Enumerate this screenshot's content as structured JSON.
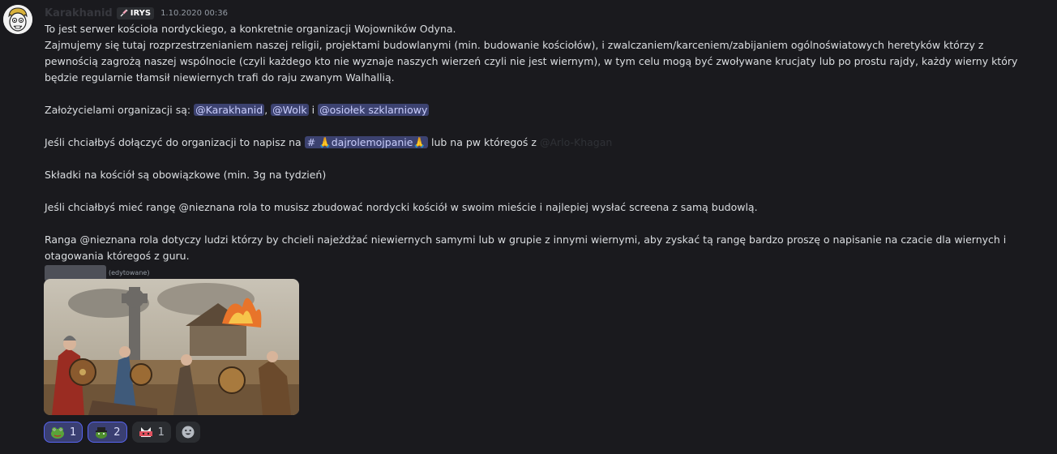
{
  "message": {
    "author": "Karakhanid",
    "role_badge": "IRYS",
    "timestamp": "1.10.2020 00:36",
    "line1": "To jest serwer kościoła nordyckiego, a konkretnie organizacji Wojowników Odyna.",
    "line2": "Zajmujemy się tutaj rozprzestrzenianiem naszej religii, projektami budowlanymi (min. budowanie kościołów), i zwalczaniem/karceniem/zabijaniem ogólnoświatowych heretyków którzy z pewnością zagrożą naszej wspólnocie (czyli każdego kto nie wyznaje naszych wierzeń czyli nie jest wiernym), w tym celu mogą być zwoływane krucjaty lub po prostu rajdy, każdy wierny który będzie regularnie tłamsił niewiernych trafi do raju zwanym Walhallią.",
    "founders_prefix": "Założycielami organizacji są: ",
    "founder1": "@Karakhanid",
    "sep1": ", ",
    "founder2": "@Wolk",
    "sep2": " i ",
    "founder3": "@osiołek szklarniowy",
    "join_prefix": "Jeśli chciałbyś dołączyć do organizacji to napisz na ",
    "channel_hash": "#",
    "channel_name": "🙏dajrolemojpanie🙏",
    "join_mid": " lub na pw któregoś z ",
    "join_user": "@Arlo-Khagan",
    "dues": "Składki na kościół są obowiązkowe (min. 3g na tydzień)",
    "rank_line": "Jeśli chciałbyś mieć rangę @nieznana rola  to musisz zbudować nordycki kościół w swoim mieście i najlepiej wysłać screena z samą budowlą.",
    "rank2_line": "Ranga @nieznana rola  dotyczy ludzi którzy by chcieli najeżdżać niewiernych samymi lub w grupie z innymi wiernymi, aby zyskać tą rangę bardzo proszę o napisanie na czacie dla wiernych i otagowania któregoś z guru.",
    "edited_label": "(edytowane)"
  },
  "reactions": [
    {
      "emoji": "frog-emoji",
      "count": "1",
      "active": true
    },
    {
      "emoji": "frog-hat-emoji",
      "count": "2",
      "active": true
    },
    {
      "emoji": "cat-emoji",
      "count": "1",
      "active": false
    }
  ],
  "colors": {
    "background": "#1a1a1e",
    "mention_bg": "#3c4270",
    "mention_text": "#c9cdfb",
    "accent": "#5865f2"
  }
}
